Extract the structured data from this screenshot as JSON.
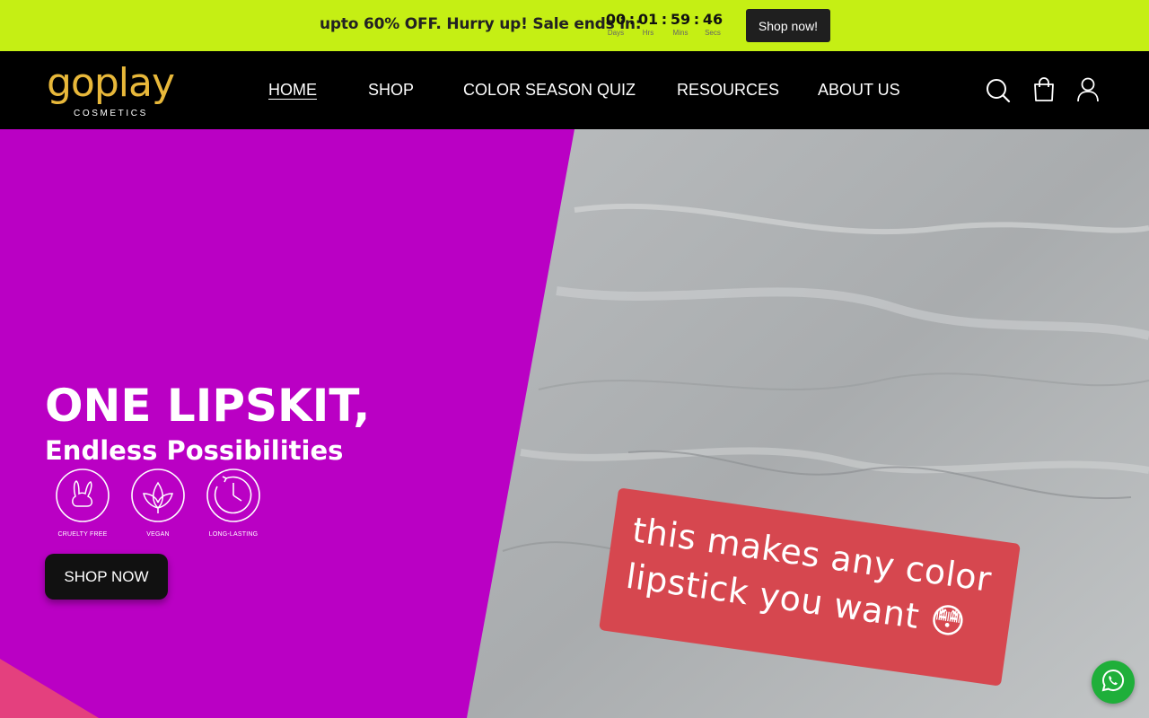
{
  "announcement": {
    "text": "upto 60% OFF. Hurry up! Sale ends in:",
    "countdown": [
      {
        "value": "00",
        "label": "Days"
      },
      {
        "value": "01",
        "label": "Hrs"
      },
      {
        "value": "59",
        "label": "Mins"
      },
      {
        "value": "46",
        "label": "Secs"
      }
    ],
    "separator": ":",
    "button_label": "Shop now!"
  },
  "header": {
    "logo_word": "goplay",
    "logo_sub": "COSMETICS",
    "nav": [
      {
        "label": "HOME",
        "active": true
      },
      {
        "label": "SHOP",
        "active": false
      },
      {
        "label": "COLOR SEASON QUIZ",
        "active": false
      },
      {
        "label": "RESOURCES",
        "active": false
      },
      {
        "label": "ABOUT US",
        "active": false
      }
    ],
    "icons": [
      "search-icon",
      "cart-icon",
      "account-icon"
    ]
  },
  "hero": {
    "title": "ONE LIPSKIT,",
    "subtitle": "Endless Possibilities",
    "badges": [
      {
        "label": "CRUELTY FREE",
        "icon": "rabbit-icon"
      },
      {
        "label": "VEGAN",
        "icon": "leaf-icon"
      },
      {
        "label": "LONG-LASTING",
        "icon": "clock-icon"
      }
    ],
    "button_label": "SHOP NOW",
    "video_caption_line1": "this makes any color",
    "video_caption_line2": "lipstick you want 😳"
  },
  "colors": {
    "announcement_bg": "#c5ef14",
    "hero_bg": "#ba00c4",
    "header_bg": "#000000",
    "logo_gold": "#e8b83a",
    "caption_bg": "#d6474f",
    "whatsapp_green": "#1faf3a"
  }
}
